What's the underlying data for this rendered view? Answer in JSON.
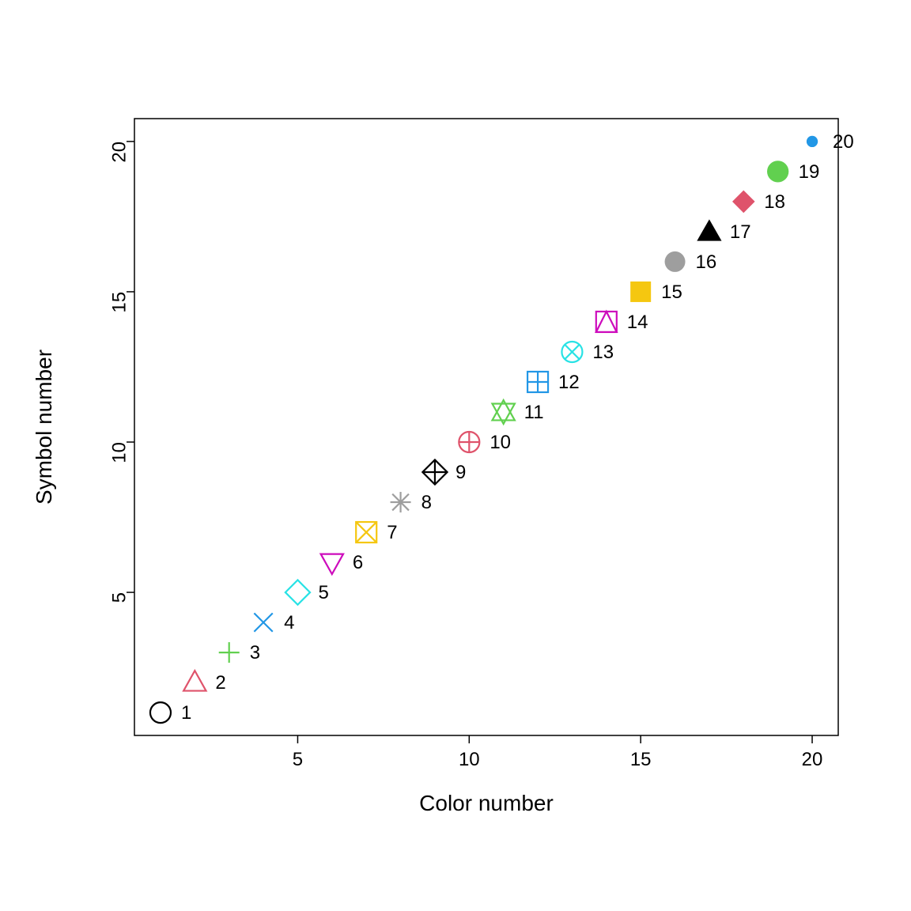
{
  "chart_data": {
    "type": "scatter",
    "title": "",
    "xlabel": "Color number",
    "ylabel": "Symbol number",
    "xlim": [
      1,
      20
    ],
    "ylim": [
      1,
      20
    ],
    "x_ticks": [
      5,
      10,
      15,
      20
    ],
    "y_ticks": [
      5,
      10,
      15,
      20
    ],
    "points": [
      {
        "x": 1,
        "y": 1,
        "label": "1",
        "pch": 1,
        "color": "#000000"
      },
      {
        "x": 2,
        "y": 2,
        "label": "2",
        "pch": 2,
        "color": "#DF536B"
      },
      {
        "x": 3,
        "y": 3,
        "label": "3",
        "pch": 3,
        "color": "#61D04F"
      },
      {
        "x": 4,
        "y": 4,
        "label": "4",
        "pch": 4,
        "color": "#2297E6"
      },
      {
        "x": 5,
        "y": 5,
        "label": "5",
        "pch": 5,
        "color": "#28E2E5"
      },
      {
        "x": 6,
        "y": 6,
        "label": "6",
        "pch": 6,
        "color": "#CD0BBC"
      },
      {
        "x": 7,
        "y": 7,
        "label": "7",
        "pch": 7,
        "color": "#F5C710"
      },
      {
        "x": 8,
        "y": 8,
        "label": "8",
        "pch": 8,
        "color": "#9E9E9E"
      },
      {
        "x": 9,
        "y": 9,
        "label": "9",
        "pch": 9,
        "color": "#000000"
      },
      {
        "x": 10,
        "y": 10,
        "label": "10",
        "pch": 10,
        "color": "#DF536B"
      },
      {
        "x": 11,
        "y": 11,
        "label": "11",
        "pch": 11,
        "color": "#61D04F"
      },
      {
        "x": 12,
        "y": 12,
        "label": "12",
        "pch": 12,
        "color": "#2297E6"
      },
      {
        "x": 13,
        "y": 13,
        "label": "13",
        "pch": 13,
        "color": "#28E2E5"
      },
      {
        "x": 14,
        "y": 14,
        "label": "14",
        "pch": 14,
        "color": "#CD0BBC"
      },
      {
        "x": 15,
        "y": 15,
        "label": "15",
        "pch": 15,
        "color": "#F5C710"
      },
      {
        "x": 16,
        "y": 16,
        "label": "16",
        "pch": 16,
        "color": "#9E9E9E"
      },
      {
        "x": 17,
        "y": 17,
        "label": "17",
        "pch": 17,
        "color": "#000000"
      },
      {
        "x": 18,
        "y": 18,
        "label": "18",
        "pch": 18,
        "color": "#DF536B"
      },
      {
        "x": 19,
        "y": 19,
        "label": "19",
        "pch": 19,
        "color": "#61D04F"
      },
      {
        "x": 20,
        "y": 20,
        "label": "20",
        "pch": 20,
        "color": "#2297E6"
      }
    ]
  }
}
